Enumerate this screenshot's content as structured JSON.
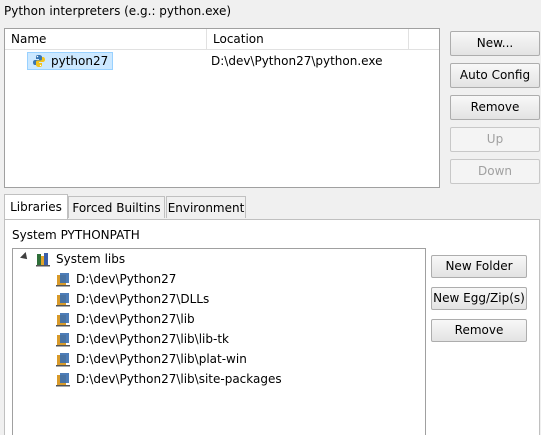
{
  "interpreters": {
    "title": "Python interpreters (e.g.: python.exe)",
    "columns": [
      "Name",
      "Location"
    ],
    "rows": [
      {
        "name": "python27",
        "location": "D:\\dev\\Python27\\python.exe"
      }
    ]
  },
  "interp_buttons": {
    "new": "New...",
    "auto_config": "Auto Config",
    "remove": "Remove",
    "up": "Up",
    "down": "Down"
  },
  "tabs": [
    "Libraries",
    "Forced Builtins",
    "Environment"
  ],
  "libraries": {
    "label": "System PYTHONPATH",
    "root": "System libs",
    "paths": [
      "D:\\dev\\Python27",
      "D:\\dev\\Python27\\DLLs",
      "D:\\dev\\Python27\\lib",
      "D:\\dev\\Python27\\lib\\lib-tk",
      "D:\\dev\\Python27\\lib\\plat-win",
      "D:\\dev\\Python27\\lib\\site-packages"
    ]
  },
  "lib_buttons": {
    "new_folder": "New Folder",
    "new_egg": "New Egg/Zip(s)",
    "remove": "Remove"
  },
  "icons": {
    "python": "python-icon",
    "library": "library-icon"
  },
  "colors": {
    "selection_bg": "#cce8ff",
    "selection_border": "#99d1ff",
    "disabled_text": "#a0a0a0"
  }
}
